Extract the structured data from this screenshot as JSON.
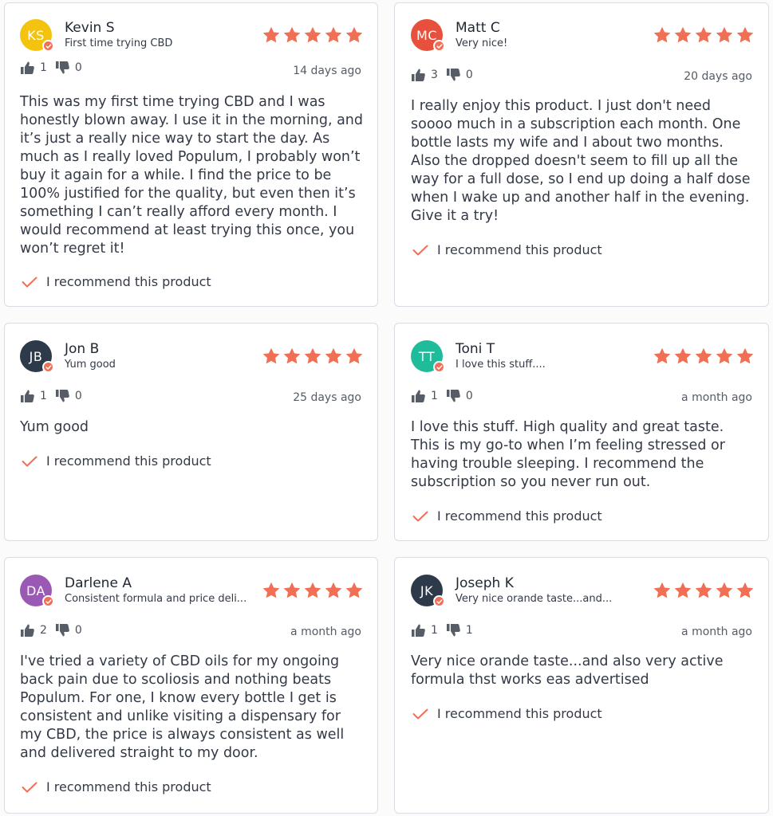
{
  "colors": {
    "star": "#f06f55",
    "check": "#f06f55",
    "badge": "#f06f55"
  },
  "reviews": [
    {
      "initials": "KS",
      "avatar_color": "#f4c30f",
      "name": "Kevin S",
      "title": "First time trying CBD",
      "rating": 5,
      "helpful_yes": "1",
      "helpful_no": "0",
      "date": "14 days ago",
      "body": "This was my first time trying CBD and I was honestly blown away. I use it in the morning, and it’s just a really nice way to start the day. As much as I really loved Populum, I probably won’t buy it again for a while. I find the price to be 100% justified for the quality, but even then it’s something I can’t really afford every month. I would recommend at least trying this once, you won’t regret it!",
      "recommend": "I recommend this product"
    },
    {
      "initials": "MC",
      "avatar_color": "#e8503e",
      "name": "Matt C",
      "title": "Very nice!",
      "rating": 5,
      "helpful_yes": "3",
      "helpful_no": "0",
      "date": "20 days ago",
      "body": "I really enjoy this product. I just don't need soooo much in a subscription each month. One bottle lasts my wife and I about two months. Also the dropped doesn't seem to fill up all the way for a full dose, so I end up doing a half dose when I wake up and another half in the evening. Give it a try!",
      "recommend": "I recommend this product"
    },
    {
      "initials": "JB",
      "avatar_color": "#2d3a4a",
      "name": "Jon B",
      "title": "Yum good",
      "rating": 5,
      "helpful_yes": "1",
      "helpful_no": "0",
      "date": "25 days ago",
      "body": "Yum good",
      "recommend": "I recommend this product"
    },
    {
      "initials": "TT",
      "avatar_color": "#1fbc9c",
      "name": "Toni T",
      "title": "I love this stuff....",
      "rating": 5,
      "helpful_yes": "1",
      "helpful_no": "0",
      "date": "a month ago",
      "body": "I love this stuff. High quality and great taste. This is my go-to when I’m feeling stressed or having trouble sleeping. I recommend the subscription so you never run out.",
      "recommend": "I recommend this product"
    },
    {
      "initials": "DA",
      "avatar_color": "#9b59b6",
      "name": "Darlene A",
      "title": "Consistent formula and price deli...",
      "rating": 5,
      "helpful_yes": "2",
      "helpful_no": "0",
      "date": "a month ago",
      "body": "I've tried a variety of CBD oils for my ongoing back pain due to scoliosis and nothing beats Populum. For one, I know every bottle I get is consistent and unlike visiting a dispensary for my CBD, the price is always consistent as well and delivered straight to my door.",
      "recommend": "I recommend this product"
    },
    {
      "initials": "JK",
      "avatar_color": "#2d3a4a",
      "name": "Joseph K",
      "title": "Very nice orande taste...and...",
      "rating": 5,
      "helpful_yes": "1",
      "helpful_no": "1",
      "date": "a month ago",
      "body": "Very nice orande taste...and also very active formula thst works eas advertised",
      "recommend": "I recommend this product"
    }
  ]
}
